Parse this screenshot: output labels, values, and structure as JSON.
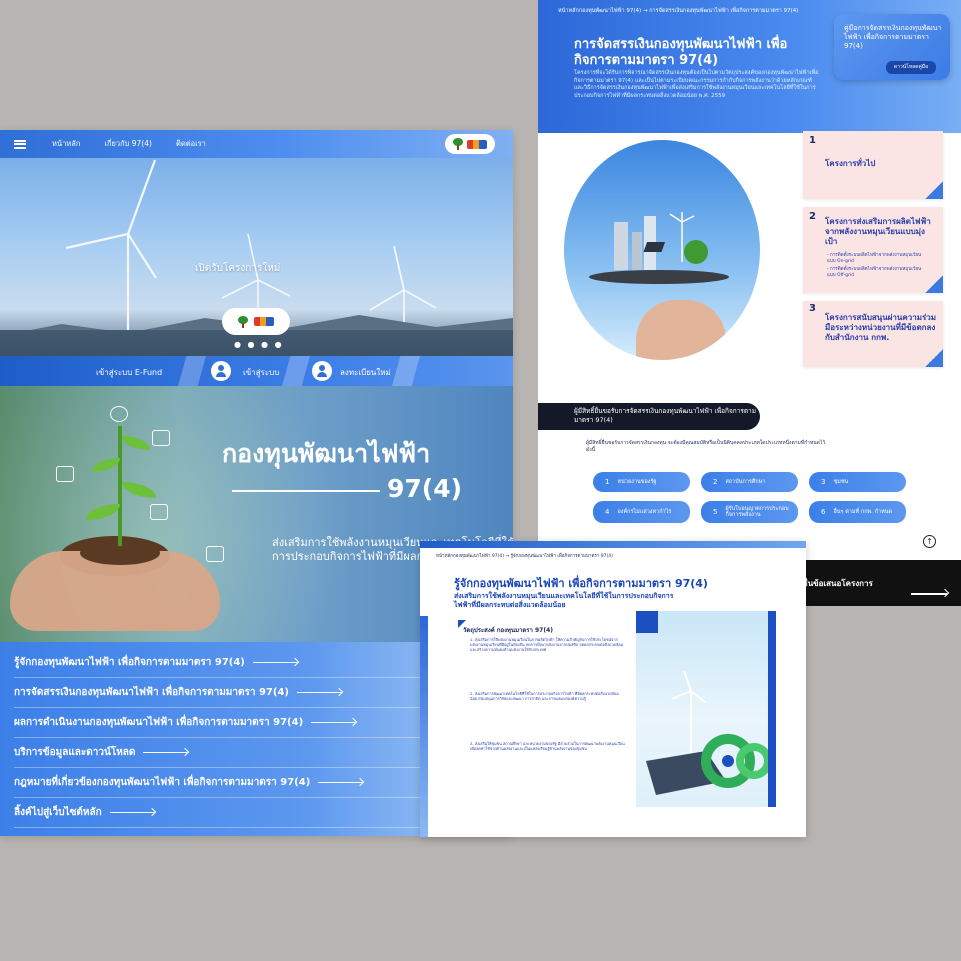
{
  "site": {
    "nav": {
      "home": "หน้าหลัก",
      "about": "เกี่ยวกับ 97(4)",
      "contact": "ติดต่อเรา"
    },
    "hero": {
      "title": "เปิดรับโครงการใหม่",
      "dots": "● ● ● ●"
    },
    "actionbar": {
      "efund": "เข้าสู่ระบบ E-Fund",
      "login": "เข้าสู่ระบบ",
      "register": "ลงทะเบียนใหม่"
    },
    "banner": {
      "title_line1": "กองทุนพัฒนาไฟฟ้า",
      "title_line2": "97(4)",
      "subtitle": "ส่งเสริมการใช้พลังงานหมุนเวียนและเทคโนโลยีที่ใช้ในการประกอบกิจการไฟฟ้าที่มีผลกระทบต่อสิ่งแวดล้อม"
    },
    "menu": [
      "รู้จักกองทุนพัฒนาไฟฟ้า เพื่อกิจการตามมาตรา 97(4)",
      "การจัดสรรเงินกองทุนพัฒนาไฟฟ้า เพื่อกิจการตามมาตรา 97(4)",
      "ผลการดำเนินงานกองทุนพัฒนาไฟฟ้า เพื่อกิจการตามมาตรา 97(4)",
      "บริการข้อมูลและดาวน์โหลด",
      "กฎหมายที่เกี่ยวข้องกองทุนพัฒนาไฟฟ้า เพื่อกิจการตามมาตรา 97(4)",
      "ลิ้งค์ไปสู่เว็บไซต์หลัก"
    ]
  },
  "allocation": {
    "breadcrumb": "หน้าหลักกองทุนพัฒนาไฟฟ้า 97(4)  →  การจัดสรรเงินกองทุนพัฒนาไฟฟ้า เพื่อกิจการตามมาตรา 97(4)",
    "title": "การจัดสรรเงินกองทุนพัฒนาไฟฟ้า เพื่อกิจการตามมาตรา 97(4)",
    "body": "โครงการที่จะได้รับการพิจารณาจัดสรรเงินกองทุนต้องเป็นไปตามวัตถุประสงค์ของกองทุนพัฒนาไฟฟ้าเพื่อกิจการตามมาตรา 97(4) และเป็นไปตามระเบียบคณะกรรมการกำกับกิจการพลังงานว่าด้วยหลักเกณฑ์และวิธีการจัดสรรเงินกองทุนพัฒนาไฟฟ้าเพื่อส่งเสริมการใช้พลังงานหมุนเวียนและเทคโนโลยีที่ใช้ในการประกอบกิจการไฟฟ้าที่มีผลกระทบต่อสิ่งแวดล้อมน้อย พ.ศ. 2559",
    "card": {
      "title": "คู่มือการจัดสรรเงินกองทุนพัฒนาไฟฟ้า เพื่อกิจการตามมาตรา 97(4)",
      "button": "ดาวน์โหลดคู่มือ"
    },
    "programs": [
      {
        "num": "1",
        "title": "โครงการทั่วไป",
        "items": []
      },
      {
        "num": "2",
        "title": "โครงการส่งเสริมการผลิตไฟฟ้าจากพลังงานหมุนเวียนแบบมุ่งเป้า",
        "items": [
          "- การติดตั้งระบบผลิตไฟฟ้าจากพลังงานหมุนเวียนแบบ On-grid",
          "- การติดตั้งระบบผลิตไฟฟ้าจากพลังงานหมุนเวียนแบบ Off-grid"
        ]
      },
      {
        "num": "3",
        "title": "โครงการสนับสนุนผ่านความร่วมมือระหว่างหน่วยงานที่มีข้อตกลงกับสำนักงาน กกพ.",
        "items": []
      }
    ],
    "eligible_title": "ผู้มีสิทธิ์ยื่นขอรับการจัดสรรเงินกองทุนพัฒนาไฟฟ้า เพื่อกิจการตามมาตรา 97(4)",
    "eligible_desc": "ผู้มีสิทธิ์ยื่นขอรับการจัดสรรเงินกองทุน จะต้องมีคุณสมบัติหรือเป็นนิติบุคคลประเภทใดประเภทหนึ่งตามที่กำหนดไว้ ดังนี้",
    "eligible": [
      {
        "num": "1",
        "label": "หน่วยงานของรัฐ"
      },
      {
        "num": "2",
        "label": "สถาบันการศึกษา"
      },
      {
        "num": "3",
        "label": "ชุมชน"
      },
      {
        "num": "4",
        "label": "องค์กรไม่แสวงหากำไร"
      },
      {
        "num": "5",
        "label": "ผู้รับใบอนุญาตการประกอบกิจการพลังงาน"
      },
      {
        "num": "6",
        "label": "อื่นๆ ตามที่ กกพ. กำหนด"
      }
    ],
    "up": "↑",
    "submit": "ยื่นข้อเสนอโครงการ"
  },
  "about": {
    "breadcrumb": "หน้าหลักกองทุนพัฒนาไฟฟ้า 97(4)  →  รู้จักกองทุนพัฒนาไฟฟ้า เพื่อกิจการตามมาตรา 97(4)",
    "title": "รู้จักกองทุนพัฒนาไฟฟ้า เพื่อกิจการตามมาตรา 97(4)",
    "subtitle": "ส่งเสริมการใช้พลังงานหมุนเวียนและเทคโนโลยีที่ใช้ในการประกอบกิจการไฟฟ้าที่มีผลกระทบต่อสิ่งแวดล้อมน้อย",
    "objectives_title": "วัตถุประสงค์ กองทุนมาตรา 97(4)",
    "objectives": [
      "1. ส่งเสริมการใช้พลังงานหมุนเวียนในการผลิตไฟฟ้า ให้ความสำคัญกับการใช้ประโยชน์จากพลังงานหมุนเวียนที่มีอยู่ในท้องถิ่น ลดการพึ่งพาพลังงานจากฟอสซิล ลดผลกระทบต่อสิ่งแวดล้อม และสร้างความมั่นคงด้านพลังงานให้กับประเทศ",
      "2. ส่งเสริมการพัฒนาเทคโนโลยีที่ใช้ในการประกอบกิจการไฟฟ้า ที่มีผลกระทบต่อสิ่งแวดล้อมน้อย สนับสนุนการวิจัยและพัฒนา การสาธิต และการเผยแพร่องค์ความรู้",
      "3. ส่งเสริมให้ชุมชน สถานศึกษา และหน่วยงานของรัฐ มีส่วนร่วมในการพัฒนาพลังงานหมุนเวียน เพื่อลดค่าใช้จ่ายด้านพลังงานและเป็นแหล่งเรียนรู้ด้านพลังงานของชุมชน"
    ]
  }
}
